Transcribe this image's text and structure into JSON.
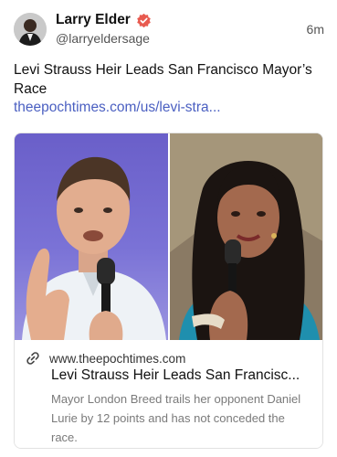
{
  "author": {
    "name": "Larry Elder",
    "handle": "@larryeldersage",
    "verified_color": "#e85a4f"
  },
  "timestamp": "6m",
  "post": {
    "text": "Levi Strauss Heir Leads San Francisco Mayor’s Race",
    "link": "theepochtimes.com/us/levi-stra..."
  },
  "link_card": {
    "domain": "www.theepochtimes.com",
    "title": "Levi Strauss Heir Leads San Francisc...",
    "description": "Mayor London Breed trails her opponent Daniel Lurie by 12 points and has not conceded the race."
  },
  "colors": {
    "link": "#4a5fc1",
    "left_photo_bg": "#6a5fc9"
  },
  "icons": [
    "verified-badge-icon",
    "link-icon"
  ]
}
